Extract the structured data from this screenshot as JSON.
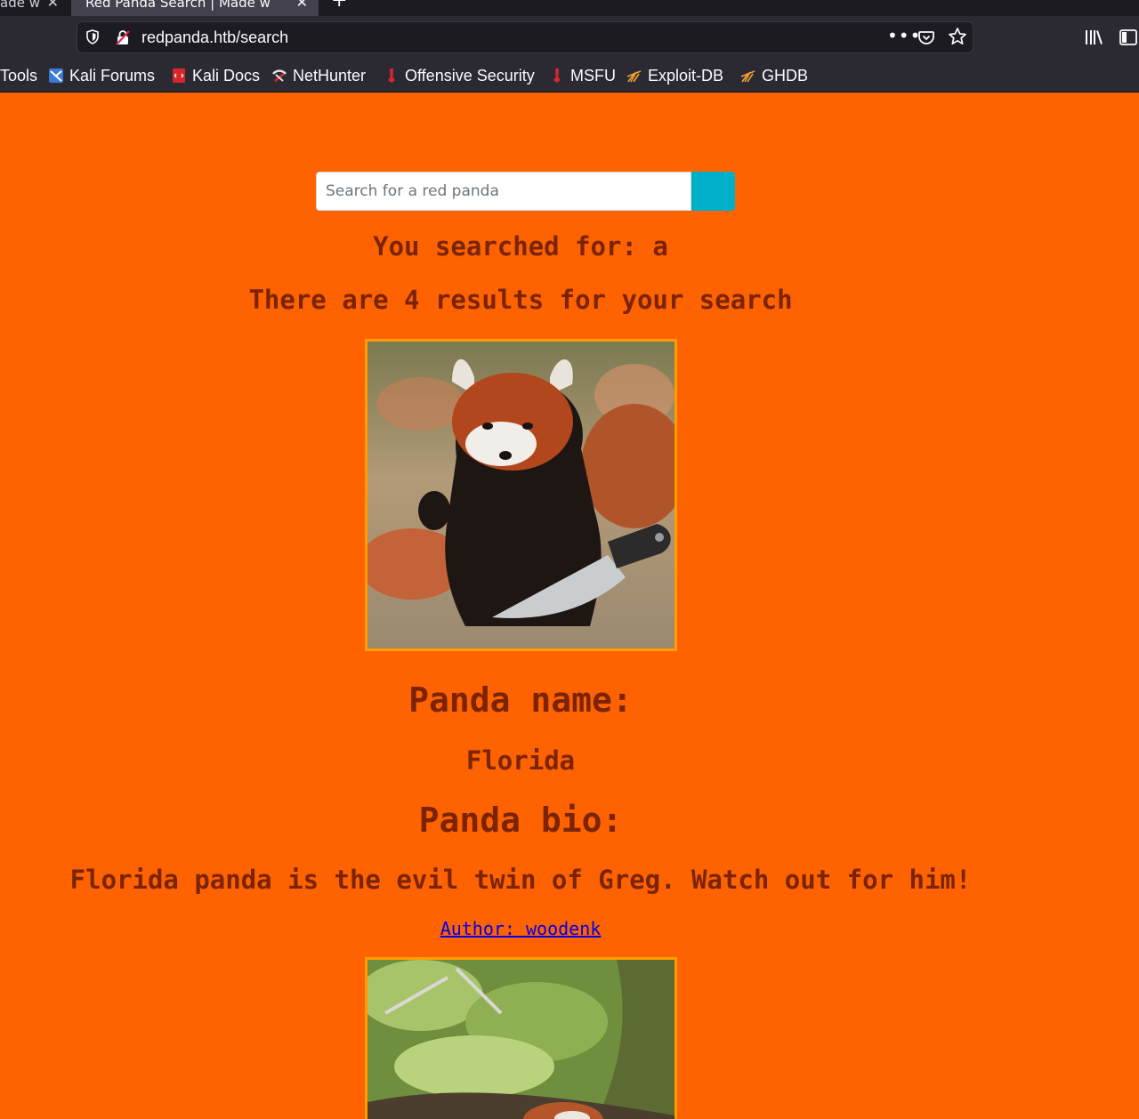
{
  "browser": {
    "tabs": [
      {
        "title": "ade w",
        "active": false
      },
      {
        "title": "Red Panda Search | Made w",
        "active": true
      }
    ],
    "new_tab": "+",
    "close_glyph": "✕",
    "url": "redpanda.htb/search",
    "page_actions_glyph": "•••",
    "icons": [
      "shield-icon",
      "insecure-lock-icon",
      "pocket-icon",
      "star-icon",
      "library-icon",
      "sidebar-icon"
    ]
  },
  "bookmarks": [
    {
      "label": "Tools",
      "icon": null
    },
    {
      "label": "Kali Forums",
      "icon": "kali-forums-icon"
    },
    {
      "label": "Kali Docs",
      "icon": "kali-docs-icon"
    },
    {
      "label": "NetHunter",
      "icon": "nethunter-icon"
    },
    {
      "label": "Offensive Security",
      "icon": "offsec-icon"
    },
    {
      "label": "MSFU",
      "icon": "msfu-icon"
    },
    {
      "label": "Exploit-DB",
      "icon": "exploit-db-icon"
    },
    {
      "label": "GHDB",
      "icon": "ghdb-icon"
    }
  ],
  "search": {
    "placeholder": "Search for a red panda",
    "button_color": "#00b0c8"
  },
  "results": {
    "searched_text": "You searched for: a",
    "count_text": "There are 4 results for your search"
  },
  "panda": {
    "name_heading": "Panda name:",
    "name": "Florida",
    "bio_heading": "Panda bio:",
    "bio": "Florida panda is the evil twin of Greg. Watch out for him!",
    "author": "Author: woodenk"
  },
  "colors": {
    "page_background": "#ff6200",
    "text": "#7a2405",
    "image_border": "#ff9d00",
    "link": "#0000ee"
  }
}
